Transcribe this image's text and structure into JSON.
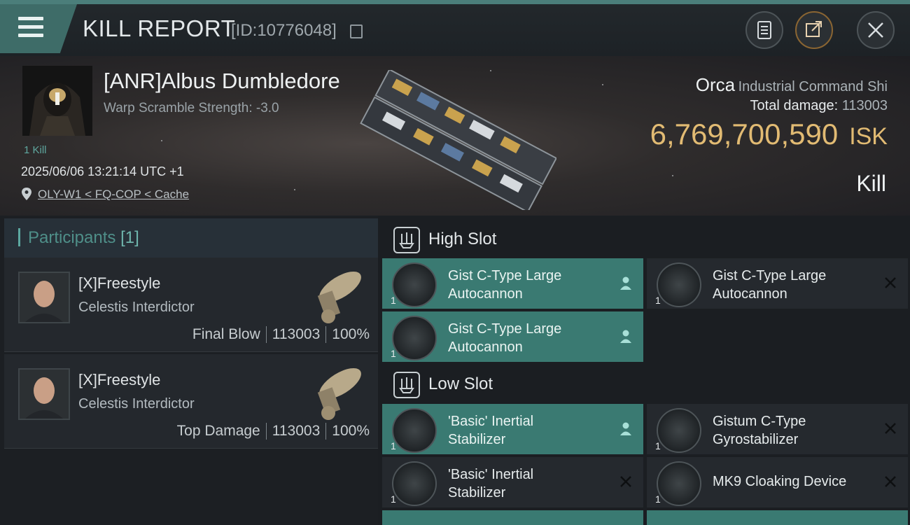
{
  "header": {
    "title": "KILL REPORT",
    "report_id": "[ID:10776048]",
    "icons": {
      "menu": "hamburger-menu-icon",
      "copy": "copy-icon",
      "clipboard": "clipboard-icon",
      "share": "share-icon",
      "close": "close-icon"
    }
  },
  "victim": {
    "name": "[ANR]Albus Dumbledore",
    "warp_scramble": "Warp Scramble Strength: -3.0",
    "kill_count": "1 Kill",
    "timestamp": "2025/06/06 13:21:14 UTC +1",
    "location": "OLY-W1 < FQ-COP < Cache"
  },
  "ship": {
    "name": "Orca",
    "class": "Industrial Command Shi",
    "damage_label": "Total damage:",
    "damage_value": "113003",
    "isk_value": "6,769,700,590",
    "isk_unit": "ISK",
    "result": "Kill"
  },
  "participants": {
    "title": "Participants",
    "count": "[1]",
    "rows": [
      {
        "name": "[X]Freestyle",
        "ship": "Celestis Interdictor",
        "role": "Final Blow",
        "damage": "113003",
        "percent": "100%"
      },
      {
        "name": "[X]Freestyle",
        "ship": "Celestis Interdictor",
        "role": "Top Damage",
        "damage": "113003",
        "percent": "100%"
      }
    ]
  },
  "fitting": {
    "high_slot": {
      "title": "High Slot",
      "modules": [
        {
          "line1": "Gist C-Type Large",
          "line2": "Autocannon",
          "qty": "1",
          "status": "person-icon"
        },
        {
          "line1": "Gist C-Type Large",
          "line2": "Autocannon",
          "qty": "1",
          "status": "close-x-icon"
        },
        {
          "line1": "Gist C-Type Large",
          "line2": "Autocannon",
          "qty": "1",
          "status": "person-icon"
        }
      ]
    },
    "low_slot": {
      "title": "Low Slot",
      "modules": [
        {
          "line1": "'Basic' Inertial",
          "line2": "Stabilizer",
          "qty": "1",
          "status": "person-icon"
        },
        {
          "line1": "Gistum C-Type",
          "line2": "Gyrostabilizer",
          "qty": "1",
          "status": "close-x-icon"
        },
        {
          "line1": "'Basic' Inertial",
          "line2": "Stabilizer",
          "qty": "1",
          "status": "close-x-icon"
        },
        {
          "line1": "MK9 Cloaking Device",
          "line2": "",
          "qty": "1",
          "status": "close-x-icon"
        }
      ]
    }
  },
  "colors": {
    "accent_teal": "#3a7a72",
    "isk_gold": "#e2bb73",
    "share_ring": "#8a6532"
  }
}
